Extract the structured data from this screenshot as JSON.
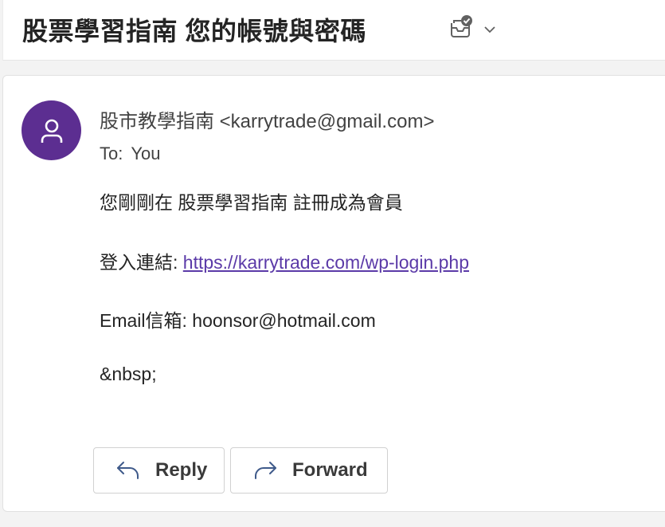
{
  "header": {
    "subject": "股票學習指南 您的帳號與密碼",
    "actions_icon": "envelope-checkmark-icon",
    "chevron_icon": "chevron-down-icon"
  },
  "message": {
    "avatar_icon": "person-icon",
    "avatar_color": "#5c2e91",
    "sender": "股市教學指南 <karrytrade@gmail.com>",
    "to_label": "To:",
    "to_value": "You",
    "body": {
      "line1": "您剛剛在 股票學習指南 註冊成為會員",
      "login_label": "登入連結: ",
      "login_link": "https://karrytrade.com/wp-login.php",
      "email_label": "Email信箱: ",
      "email_value": "hoonsor@hotmail.com",
      "line4": "&nbsp;"
    },
    "link_color": "#5b3aa8"
  },
  "actions": {
    "reply_label": "Reply",
    "reply_icon": "reply-arrow-icon",
    "forward_label": "Forward",
    "forward_icon": "forward-arrow-icon"
  }
}
